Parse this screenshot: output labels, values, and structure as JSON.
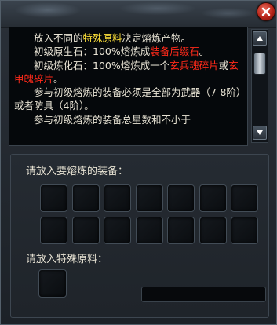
{
  "window": {
    "close_icon": "close-icon"
  },
  "description": {
    "p1_a": "放入不同的",
    "p1_b": "特殊原料",
    "p1_c": "决定熔炼产物。",
    "p2_a": "初级原生石：100%熔炼成",
    "p2_b": "装备后缀石",
    "p2_c": "。",
    "p3_a": "初级炼化石：100%熔炼成一个",
    "p3_b": "玄兵魂碎片",
    "p3_c": "或",
    "p3_d": "玄甲魄碎片",
    "p3_e": "。",
    "p4": "参与初级熔炼的装备必须是全部为武器（7-8阶）或者防具（4阶）。",
    "p5": "参与初级熔炼的装备总星数和不小于"
  },
  "scrollbar": {
    "up_icon": "arrow-up-icon",
    "down_icon": "arrow-down-icon"
  },
  "equipment": {
    "label": "请放入要熔炼的装备：",
    "slot_count": 14
  },
  "special_material": {
    "label": "请放入特殊原料：",
    "input_value": ""
  },
  "colors": {
    "highlight_red": "#ff2a1a",
    "highlight_yellow": "#ffe23a",
    "text": "#e8e3d4",
    "close_button": "#b72418"
  }
}
